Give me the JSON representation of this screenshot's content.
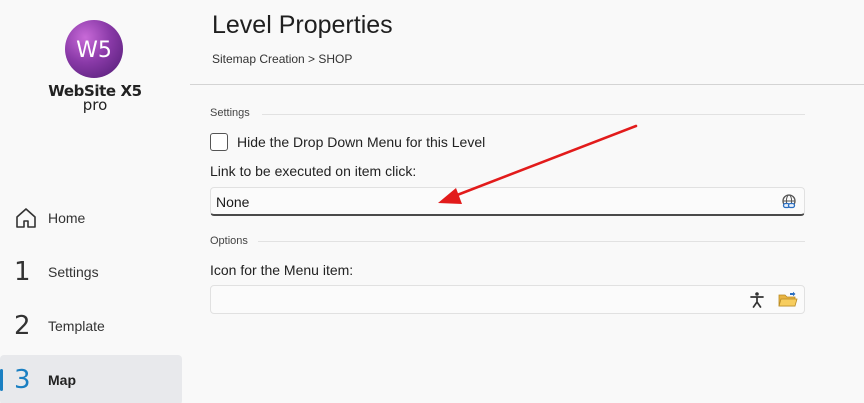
{
  "brand": {
    "logo_mark": "W5",
    "name": "WebSite X5",
    "edition": "pro"
  },
  "nav": {
    "items": [
      {
        "number": "",
        "label": "Home",
        "icon": "home-icon"
      },
      {
        "number": "1",
        "label": "Settings"
      },
      {
        "number": "2",
        "label": "Template"
      },
      {
        "number": "3",
        "label": "Map",
        "active": true
      }
    ]
  },
  "header": {
    "title": "Level Properties",
    "breadcrumb": "Sitemap Creation > SHOP"
  },
  "settings": {
    "section_label": "Settings",
    "hide_dropdown_label": "Hide the Drop Down Menu for this Level",
    "hide_dropdown_checked": false,
    "link_label": "Link to be executed on item click:",
    "link_value": "None"
  },
  "options": {
    "section_label": "Options",
    "icon_label": "Icon for the Menu item:",
    "icon_value": ""
  },
  "colors": {
    "accent": "#1a7fc2",
    "annotation_arrow": "#e21b1b",
    "logo_purple": "#8a3aa8"
  }
}
